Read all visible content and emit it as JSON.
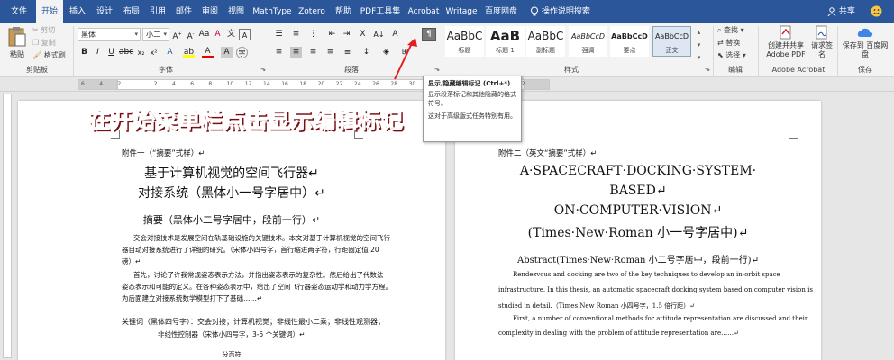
{
  "menu_tabs": [
    "文件",
    "开始",
    "插入",
    "设计",
    "布局",
    "引用",
    "邮件",
    "审阅",
    "视图",
    "MathType",
    "Zotero",
    "帮助",
    "PDF工具集",
    "Acrobat",
    "Writage",
    "百度网盘"
  ],
  "tell_me": "操作说明搜索",
  "share": "共享",
  "clipboard": {
    "paste": "粘贴",
    "cut": "剪切",
    "copy": "复制",
    "format_painter": "格式刷",
    "label": "剪贴板"
  },
  "font": {
    "name": "黑体",
    "size": "小二",
    "label": "字体"
  },
  "paragraph": {
    "label": "段落"
  },
  "styles": {
    "items": [
      {
        "sample": "AaBbC",
        "name": "标题"
      },
      {
        "sample": "AaB",
        "name": "标题 1"
      },
      {
        "sample": "AaBbC",
        "name": "副标题"
      },
      {
        "sample": "AaBbCcD",
        "name": "强调"
      },
      {
        "sample": "AaBbCcD",
        "name": "要点"
      },
      {
        "sample": "AaBbCcD",
        "name": "正文"
      }
    ],
    "label": "样式"
  },
  "editing": {
    "find": "查找",
    "replace": "替换",
    "select": "选择",
    "label": "编辑"
  },
  "acrobat": {
    "create_share": "创建并共享 Adobe PDF",
    "request_sign": "请求签名",
    "label": "Adobe Acrobat"
  },
  "baidu": {
    "save": "保存到 百度网盘",
    "label": "保存"
  },
  "ruler_numbers": [
    "6",
    "4",
    "2",
    "",
    "2",
    "4",
    "6",
    "8",
    "10",
    "12",
    "14",
    "16",
    "18",
    "20",
    "22",
    "24",
    "26",
    "28",
    "30",
    "32",
    "34",
    "36",
    "38",
    "40",
    "42"
  ],
  "tooltip": {
    "title": "显示/隐藏编辑标记 (Ctrl+*)",
    "p1": "显示段落标记和其他隐藏的格式符号。",
    "p2": "这对于高级版式任务特别有用。"
  },
  "banner": "在开始菜单栏点击显示编辑标记",
  "left_page": {
    "appendix": "附件一（“摘要”式样）↵",
    "title1": "基于计算机视觉的空间飞行器↵",
    "title2": "对接系统（黑体小一号字居中）↵",
    "abstract_head": "摘要（黑体小二号字居中，段前一行）↵",
    "p1a": "交会对接技术是发展空间在轨基础设施的关键技术。本文对基于计算机视觉的空间飞行",
    "p1b": "器自动对接系统进行了详细的研究。（宋体小四号字，首行缩进两字符，行距固定值 20",
    "p1c": "磅）↵",
    "p2a": "首先，讨论了许我常规姿态表示方法，并指出姿态表示的复杂性。然后给出了代数法",
    "p2b": "姿态表示和可能的定义。在各种姿态表示中，给出了空间飞行器姿态运动学和动力学方程。",
    "p2c": "为后面建立对接系统数学模型打下了基础……↵",
    "keywords": "关键词（黑体四号字）：交会对接；计算机视觉；非线性最小二乘；非线性观测器；",
    "keywords2": "非线性控制器（宋体小四号字，3-5 个关键词）↵",
    "section_break": "分页符"
  },
  "right_page": {
    "appendix": "附件二（英文“摘要”式样）↵",
    "title1": "A·SPACECRAFT·DOCKING·SYSTEM·",
    "title2": "BASED↵",
    "title3": "ON·COMPUTER·VISION↵",
    "title4": "(Times·New·Roman 小一号字居中)↵",
    "abstract_head": "Abstract(Times·New·Roman 小二号字居中，段前一行)↵",
    "p1a": "Rendezvous and docking are two of the key techniques to develop an in-orbit space",
    "p1b": "infrastructure. In this thesis, an automatic spacecraft docking system based on computer vision is",
    "p1c": "studied in detail.（Times New Roman 小四号字，1.5 倍行距）↵",
    "p2a": "First, a number of conventional methods for attitude representation are discussed and their",
    "p2b": "complexity in dealing with the problem of attitude representation are……↵"
  },
  "colors": {
    "ribbon_blue": "#2b579a",
    "banner_red": "#d11f2b"
  }
}
